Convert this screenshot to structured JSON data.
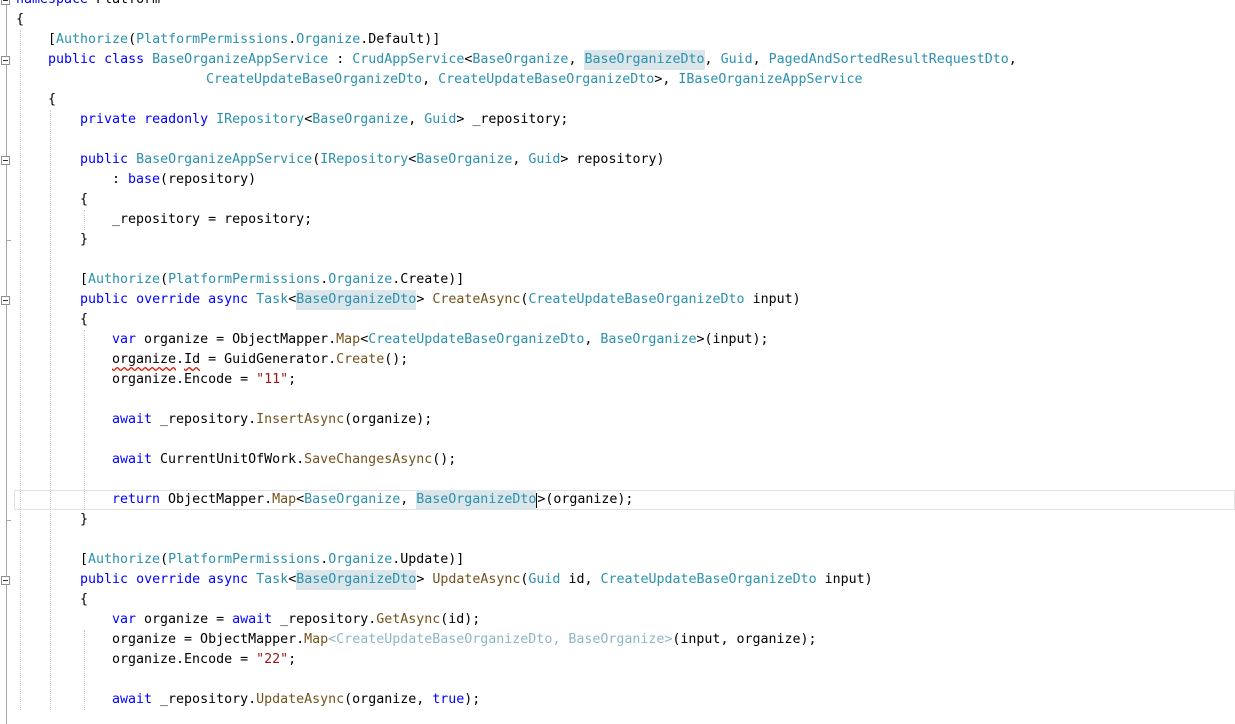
{
  "editor": {
    "colors": {
      "keyword": "#0000ff",
      "type": "#2b91af",
      "method": "#74531f",
      "string": "#a31515",
      "highlight": "#dbe6ea",
      "error": "#e51400"
    },
    "lines": [
      {
        "indent": 0,
        "fold": true,
        "tokens": [
          [
            "kw",
            "namespace"
          ],
          [
            "pl",
            " Platform"
          ]
        ]
      },
      {
        "indent": 0,
        "tokens": [
          [
            "pl",
            "{"
          ]
        ]
      },
      {
        "indent": 1,
        "tokens": [
          [
            "pl",
            "["
          ],
          [
            "ty",
            "Authorize"
          ],
          [
            "pl",
            "("
          ],
          [
            "ty",
            "PlatformPermissions"
          ],
          [
            "pl",
            "."
          ],
          [
            "ty",
            "Organize"
          ],
          [
            "pl",
            ".Default)]"
          ]
        ]
      },
      {
        "indent": 1,
        "fold": true,
        "tokens": [
          [
            "kw",
            "public"
          ],
          [
            "pl",
            " "
          ],
          [
            "kw",
            "class"
          ],
          [
            "pl",
            " "
          ],
          [
            "ty",
            "BaseOrganizeAppService"
          ],
          [
            "pl",
            " : "
          ],
          [
            "ty",
            "CrudAppService"
          ],
          [
            "pl",
            "<"
          ],
          [
            "ty",
            "BaseOrganize"
          ],
          [
            "pl",
            ", "
          ],
          [
            "hl",
            "BaseOrganizeDto"
          ],
          [
            "pl",
            ", "
          ],
          [
            "ty",
            "Guid"
          ],
          [
            "pl",
            ", "
          ],
          [
            "ty",
            "PagedAndSortedResultRequestDto"
          ],
          [
            "pl",
            ","
          ]
        ]
      },
      {
        "indent": 0,
        "pad": 206,
        "tokens": [
          [
            "ty",
            "CreateUpdateBaseOrganizeDto"
          ],
          [
            "pl",
            ", "
          ],
          [
            "ty",
            "CreateUpdateBaseOrganizeDto"
          ],
          [
            "pl",
            ">, "
          ],
          [
            "ty",
            "IBaseOrganizeAppService"
          ]
        ]
      },
      {
        "indent": 1,
        "tokens": [
          [
            "pl",
            "{"
          ]
        ]
      },
      {
        "indent": 2,
        "tokens": [
          [
            "kw",
            "private"
          ],
          [
            "pl",
            " "
          ],
          [
            "kw",
            "readonly"
          ],
          [
            "pl",
            " "
          ],
          [
            "ty",
            "IRepository"
          ],
          [
            "pl",
            "<"
          ],
          [
            "ty",
            "BaseOrganize"
          ],
          [
            "pl",
            ", "
          ],
          [
            "ty",
            "Guid"
          ],
          [
            "pl",
            "> _repository;"
          ]
        ]
      },
      {
        "indent": 2,
        "tokens": []
      },
      {
        "indent": 2,
        "fold": true,
        "tokens": [
          [
            "kw",
            "public"
          ],
          [
            "pl",
            " "
          ],
          [
            "ty",
            "BaseOrganizeAppService"
          ],
          [
            "pl",
            "("
          ],
          [
            "ty",
            "IRepository"
          ],
          [
            "pl",
            "<"
          ],
          [
            "ty",
            "BaseOrganize"
          ],
          [
            "pl",
            ", "
          ],
          [
            "ty",
            "Guid"
          ],
          [
            "pl",
            "> repository)"
          ]
        ]
      },
      {
        "indent": 3,
        "tokens": [
          [
            "pl",
            ": "
          ],
          [
            "kw",
            "base"
          ],
          [
            "pl",
            "(repository)"
          ]
        ]
      },
      {
        "indent": 2,
        "tokens": [
          [
            "pl",
            "{"
          ]
        ]
      },
      {
        "indent": 3,
        "tokens": [
          [
            "pl",
            "_repository = repository;"
          ]
        ]
      },
      {
        "indent": 2,
        "foldEnd": true,
        "tokens": [
          [
            "pl",
            "}"
          ]
        ]
      },
      {
        "indent": 2,
        "tokens": []
      },
      {
        "indent": 2,
        "tokens": [
          [
            "pl",
            "["
          ],
          [
            "ty",
            "Authorize"
          ],
          [
            "pl",
            "("
          ],
          [
            "ty",
            "PlatformPermissions"
          ],
          [
            "pl",
            "."
          ],
          [
            "ty",
            "Organize"
          ],
          [
            "pl",
            ".Create)]"
          ]
        ]
      },
      {
        "indent": 2,
        "fold": true,
        "tokens": [
          [
            "kw",
            "public"
          ],
          [
            "pl",
            " "
          ],
          [
            "kw",
            "override"
          ],
          [
            "pl",
            " "
          ],
          [
            "kw",
            "async"
          ],
          [
            "pl",
            " "
          ],
          [
            "ty",
            "Task"
          ],
          [
            "pl",
            "<"
          ],
          [
            "hl",
            "BaseOrganizeDto"
          ],
          [
            "pl",
            "> "
          ],
          [
            "mt",
            "CreateAsync"
          ],
          [
            "pl",
            "("
          ],
          [
            "ty",
            "CreateUpdateBaseOrganizeDto"
          ],
          [
            "pl",
            " input)"
          ]
        ]
      },
      {
        "indent": 2,
        "tokens": [
          [
            "pl",
            "{"
          ]
        ]
      },
      {
        "indent": 3,
        "tokens": [
          [
            "kw",
            "var"
          ],
          [
            "pl",
            " organize = ObjectMapper."
          ],
          [
            "mt",
            "Map"
          ],
          [
            "pl",
            "<"
          ],
          [
            "ty",
            "CreateUpdateBaseOrganizeDto"
          ],
          [
            "pl",
            ", "
          ],
          [
            "ty",
            "BaseOrganize"
          ],
          [
            "pl",
            ">(input);"
          ]
        ]
      },
      {
        "indent": 3,
        "tokens": [
          [
            "sq",
            "organize"
          ],
          [
            "pl",
            "."
          ],
          [
            "sq",
            "Id"
          ],
          [
            "pl",
            " = GuidGenerator."
          ],
          [
            "mt",
            "Create"
          ],
          [
            "pl",
            "();"
          ]
        ]
      },
      {
        "indent": 3,
        "tokens": [
          [
            "pl",
            "organize.Encode = "
          ],
          [
            "st",
            "\"11\""
          ],
          [
            "pl",
            ";"
          ]
        ]
      },
      {
        "indent": 3,
        "tokens": []
      },
      {
        "indent": 3,
        "tokens": [
          [
            "kw",
            "await"
          ],
          [
            "pl",
            " _repository."
          ],
          [
            "mt",
            "InsertAsync"
          ],
          [
            "pl",
            "(organize);"
          ]
        ]
      },
      {
        "indent": 3,
        "tokens": []
      },
      {
        "indent": 3,
        "tokens": [
          [
            "kw",
            "await"
          ],
          [
            "pl",
            " CurrentUnitOfWork."
          ],
          [
            "mt",
            "SaveChangesAsync"
          ],
          [
            "pl",
            "();"
          ]
        ]
      },
      {
        "indent": 3,
        "tokens": []
      },
      {
        "indent": 3,
        "current": true,
        "tokens": [
          [
            "kw",
            "return"
          ],
          [
            "pl",
            " ObjectMapper."
          ],
          [
            "mt",
            "Map"
          ],
          [
            "pl",
            "<"
          ],
          [
            "ty",
            "BaseOrganize"
          ],
          [
            "pl",
            ", "
          ],
          [
            "hl",
            "BaseOrganizeDto"
          ],
          [
            "caret",
            ""
          ],
          [
            "pl",
            ">(organize);"
          ]
        ]
      },
      {
        "indent": 2,
        "foldEnd": true,
        "tokens": [
          [
            "pl",
            "}"
          ]
        ]
      },
      {
        "indent": 2,
        "tokens": []
      },
      {
        "indent": 2,
        "tokens": [
          [
            "pl",
            "["
          ],
          [
            "ty",
            "Authorize"
          ],
          [
            "pl",
            "("
          ],
          [
            "ty",
            "PlatformPermissions"
          ],
          [
            "pl",
            "."
          ],
          [
            "ty",
            "Organize"
          ],
          [
            "pl",
            ".Update)]"
          ]
        ]
      },
      {
        "indent": 2,
        "fold": true,
        "tokens": [
          [
            "kw",
            "public"
          ],
          [
            "pl",
            " "
          ],
          [
            "kw",
            "override"
          ],
          [
            "pl",
            " "
          ],
          [
            "kw",
            "async"
          ],
          [
            "pl",
            " "
          ],
          [
            "ty",
            "Task"
          ],
          [
            "pl",
            "<"
          ],
          [
            "hl",
            "BaseOrganizeDto"
          ],
          [
            "pl",
            "> "
          ],
          [
            "mt",
            "UpdateAsync"
          ],
          [
            "pl",
            "("
          ],
          [
            "ty",
            "Guid"
          ],
          [
            "pl",
            " id, "
          ],
          [
            "ty",
            "CreateUpdateBaseOrganizeDto"
          ],
          [
            "pl",
            " input)"
          ]
        ]
      },
      {
        "indent": 2,
        "tokens": [
          [
            "pl",
            "{"
          ]
        ]
      },
      {
        "indent": 3,
        "tokens": [
          [
            "kw",
            "var"
          ],
          [
            "pl",
            " organize = "
          ],
          [
            "kw",
            "await"
          ],
          [
            "pl",
            " _repository."
          ],
          [
            "mt",
            "GetAsync"
          ],
          [
            "pl",
            "(id);"
          ]
        ]
      },
      {
        "indent": 3,
        "tokens": [
          [
            "pl",
            "organize = ObjectMapper."
          ],
          [
            "mt",
            "Map"
          ],
          [
            "dim",
            "<CreateUpdateBaseOrganizeDto, BaseOrganize>"
          ],
          [
            "pl",
            "(input, organize);"
          ]
        ]
      },
      {
        "indent": 3,
        "tokens": [
          [
            "pl",
            "organize.Encode = "
          ],
          [
            "st",
            "\"22\""
          ],
          [
            "pl",
            ";"
          ]
        ]
      },
      {
        "indent": 3,
        "tokens": []
      },
      {
        "indent": 3,
        "tokens": [
          [
            "kw",
            "await"
          ],
          [
            "pl",
            " _repository."
          ],
          [
            "mt",
            "UpdateAsync"
          ],
          [
            "pl",
            "(organize, "
          ],
          [
            "kw",
            "true"
          ],
          [
            "pl",
            ");"
          ]
        ]
      }
    ]
  }
}
